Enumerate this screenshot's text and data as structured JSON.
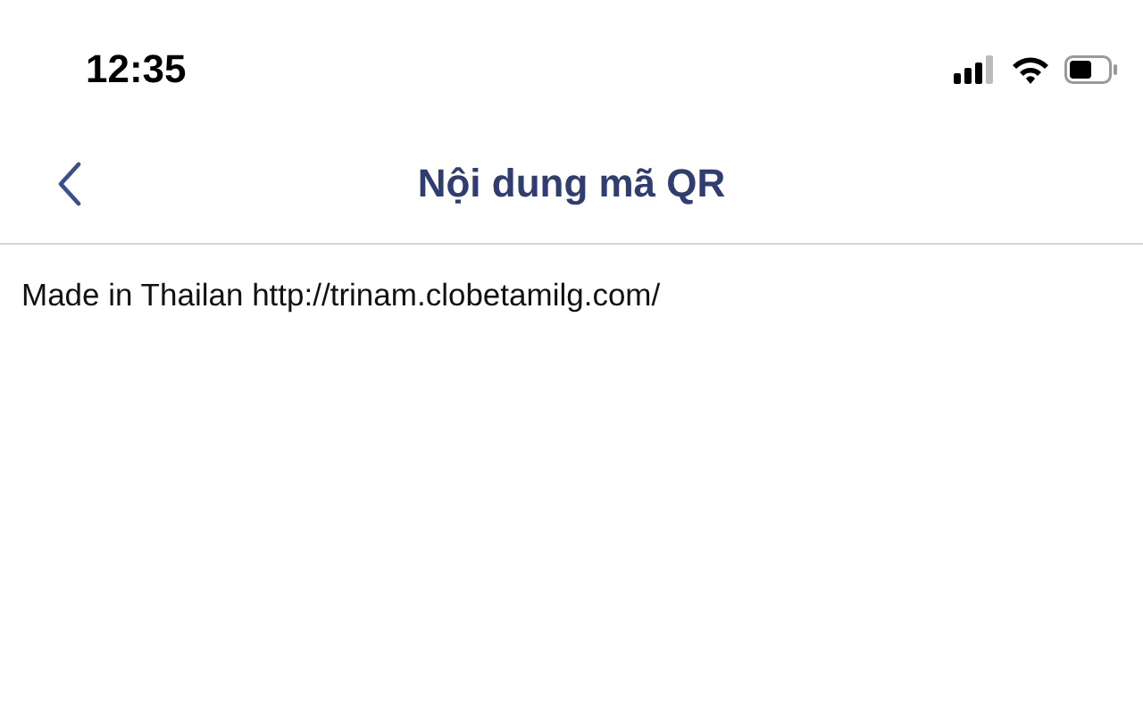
{
  "status_bar": {
    "time": "12:35"
  },
  "nav_bar": {
    "title": "Nội dung mã QR"
  },
  "content": {
    "text": "Made in Thailan http://trinam.clobetamilg.com/"
  }
}
